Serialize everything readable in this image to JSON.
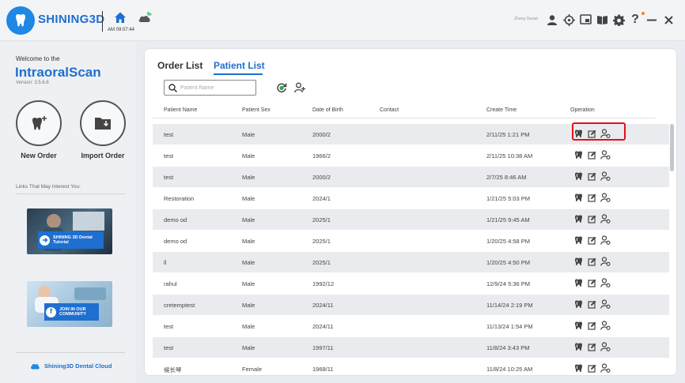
{
  "app": {
    "brand": "SHINING3D",
    "clock": "AM 09:07:44",
    "user_name": "Zhang Daoan"
  },
  "toolbar_icons": [
    "user-icon",
    "target-icon",
    "screen-icon",
    "book-icon",
    "gear-icon",
    "help-icon",
    "minimize-icon",
    "close-icon"
  ],
  "sidebar": {
    "welcome": "Welcome to the",
    "app_name": "IntraoralScan",
    "version": "Version: 3.5.6.6",
    "new_order": "New Order",
    "import_order": "Import Order",
    "links_title": "Links That May Interest You:",
    "banner1_text": "SHINING 3D Dental Tutorial",
    "banner2_text": "JOIN IN OUR COMMUNITY",
    "cloud_link": "Shining3D Dental Cloud"
  },
  "main": {
    "tabs": {
      "order_list": "Order List",
      "patient_list": "Patient List"
    },
    "search_placeholder": "Patient Name",
    "columns": {
      "name": "Patient Name",
      "sex": "Patient Sex",
      "dob": "Date of Birth",
      "contact": "Contact",
      "create_time": "Create Time",
      "operation": "Operation"
    },
    "rows": [
      {
        "name": "test",
        "sex": "Male",
        "dob": "2000/2",
        "contact": "",
        "create_time": "2/11/25 1:21 PM"
      },
      {
        "name": "test",
        "sex": "Male",
        "dob": "1966/2",
        "contact": "",
        "create_time": "2/11/25 10:38 AM"
      },
      {
        "name": "test",
        "sex": "Male",
        "dob": "2000/2",
        "contact": "",
        "create_time": "2/7/25 8:46 AM"
      },
      {
        "name": "Restoration",
        "sex": "Male",
        "dob": "2024/1",
        "contact": "",
        "create_time": "1/21/25 5:03 PM"
      },
      {
        "name": "demo od",
        "sex": "Male",
        "dob": "2025/1",
        "contact": "",
        "create_time": "1/21/25 9:45 AM"
      },
      {
        "name": "demo od",
        "sex": "Male",
        "dob": "2025/1",
        "contact": "",
        "create_time": "1/20/25 4:58 PM"
      },
      {
        "name": "ll",
        "sex": "Male",
        "dob": "2025/1",
        "contact": "",
        "create_time": "1/20/25 4:50 PM"
      },
      {
        "name": "rahul",
        "sex": "Male",
        "dob": "1992/12",
        "contact": "",
        "create_time": "12/9/24 5:36 PM"
      },
      {
        "name": "cretemptest",
        "sex": "Male",
        "dob": "2024/11",
        "contact": "",
        "create_time": "11/14/24 2:19 PM"
      },
      {
        "name": "test",
        "sex": "Male",
        "dob": "2024/11",
        "contact": "",
        "create_time": "11/13/24 1:54 PM"
      },
      {
        "name": "test",
        "sex": "Male",
        "dob": "1997/11",
        "contact": "",
        "create_time": "11/8/24 3:43 PM"
      },
      {
        "name": "候长琴",
        "sex": "Female",
        "dob": "1968/11",
        "contact": "",
        "create_time": "11/8/24 10:25 AM"
      }
    ]
  },
  "colors": {
    "accent": "#1e6fd0",
    "highlight_border": "#e3101b",
    "row_alt": "#e9ebee"
  }
}
